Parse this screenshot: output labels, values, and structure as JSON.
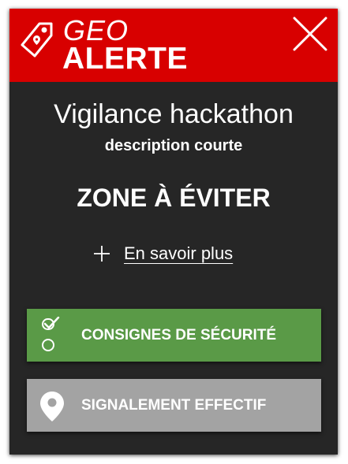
{
  "header": {
    "brand_line1": "GEO",
    "brand_line2": "ALERTE",
    "logo_icon": "tag-icon",
    "close_icon": "close-icon",
    "background_color": "#d80000"
  },
  "alert": {
    "title": "Vigilance hackathon",
    "description": "description courte",
    "zone_label": "ZONE À ÉVITER"
  },
  "more_link": {
    "icon": "plus-icon",
    "label": "En savoir plus"
  },
  "buttons": {
    "safety": {
      "label": "CONSIGNES DE SÉCURITÉ",
      "icon": "checklist-icon",
      "color": "#5a9a47"
    },
    "report": {
      "label": "SIGNALEMENT EFFECTIF",
      "icon": "location-pin-icon",
      "color": "#a3a3a3"
    }
  },
  "panel_color": "#262626"
}
